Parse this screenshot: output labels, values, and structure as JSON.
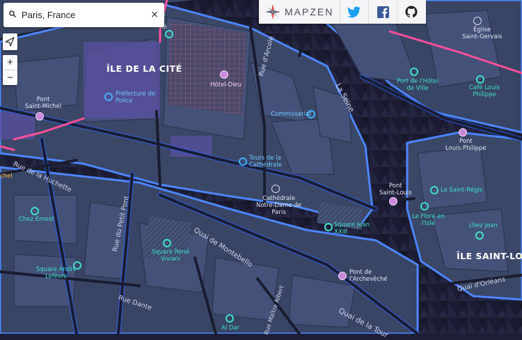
{
  "search": {
    "value": "Paris, France",
    "clear_symbol": "×"
  },
  "controls": {
    "zoom_in": "+",
    "zoom_out": "−"
  },
  "brand": {
    "name": "MAPZEN"
  },
  "social": [
    "twitter-icon",
    "facebook-icon",
    "github-icon"
  ],
  "districts": {
    "cite": "ÎLE DE LA CITÉ",
    "saint_louis": "ÎLE SAINT-LOU"
  },
  "streets": {
    "arcole": "Rue d'Arcole",
    "seine": "La Seine",
    "huchette": "Rue de la Huchette",
    "petit_pont": "Rue du Petit Pont",
    "montebello": "Quai de Montebello",
    "dante": "Rue Dante",
    "maitre_albert": "Rue Maître Albert",
    "tournelle": "Quai de la Tour",
    "orleans": "Quai d'Orléans"
  },
  "pois": {
    "hotel_dieu": "Hôtel-Dieu",
    "prefecture": "Préfecture de\nPolice",
    "commissariat": "Commissariat",
    "tours": "Tours de la\nCathédrale",
    "cathedrale": "Cathédrale\nNotre-Dame de\nParis",
    "square_jean": "Square Jean\nXXIII",
    "chez_ernest": "Chez Ernest",
    "square_rene": "Square René\nViviani",
    "square_andre": "Square André\nLefèvre",
    "al_dar": "Al Dar",
    "port_hotel": "Port de l'Hôtel\nde Ville",
    "cafe_louis": "Café Louis\nPhilippe",
    "eglise": "Église\nSaint-Gervais",
    "saint_regis": "Le Saint-Régis",
    "flore": "Le Flore en\nl'Isle",
    "chez_jean": "chez jean",
    "chez_partial": "chez",
    "ville_partial": "llé",
    "odeon_partial": "chel"
  },
  "bridges": {
    "saint_michel": "Pont\nSaint-Michel",
    "louis_philippe": "Pont\nLouis-Philippe",
    "saint_louis": "Pont\nSaint-Louis",
    "archeveche": "Pont de\nl'Archevêché"
  },
  "colors": {
    "water": "#1c1e34",
    "land": "#3a4766",
    "road_glow": "#3f7dff",
    "major_road": "#ff4f9a",
    "poi_green": "#3fe0c5",
    "poi_blue": "#45b0ff"
  }
}
